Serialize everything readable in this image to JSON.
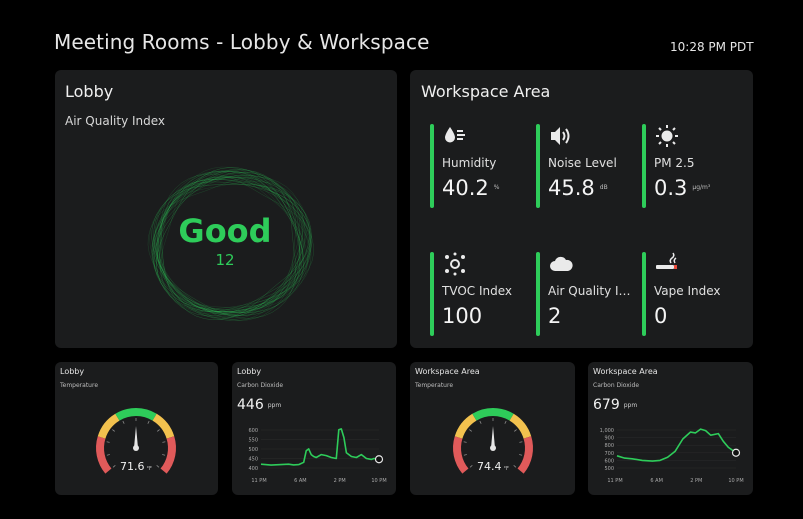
{
  "header": {
    "title": "Meeting Rooms - Lobby & Workspace",
    "time": "10:28 PM PDT"
  },
  "lobby": {
    "title": "Lobby",
    "subtitle": "Air Quality Index",
    "status": "Good",
    "value": "12",
    "status_color": "#2ecc5a"
  },
  "workspace": {
    "title": "Workspace Area",
    "metrics": [
      {
        "icon": "humidity-icon",
        "label": "Humidity",
        "value": "40.2",
        "unit": "%"
      },
      {
        "icon": "noise-icon",
        "label": "Noise Level",
        "value": "45.8",
        "unit": "dB"
      },
      {
        "icon": "sun-icon",
        "label": "PM 2.5",
        "value": "0.3",
        "unit": "µg/m³"
      },
      {
        "icon": "tvoc-icon",
        "label": "TVOC Index",
        "value": "100",
        "unit": ""
      },
      {
        "icon": "cloud-icon",
        "label": "Air Quality In...",
        "value": "2",
        "unit": ""
      },
      {
        "icon": "vape-icon",
        "label": "Vape Index",
        "value": "0",
        "unit": ""
      }
    ]
  },
  "widgets": {
    "lobby_temp": {
      "title": "Lobby",
      "subtitle": "Temperature",
      "value": "71.6",
      "unit": "°F",
      "fraction": 0.5
    },
    "lobby_co2": {
      "title": "Lobby",
      "subtitle": "Carbon Dioxide",
      "value": "446",
      "unit": "ppm"
    },
    "work_temp": {
      "title": "Workspace Area",
      "subtitle": "Temperature",
      "value": "74.4",
      "unit": "°F",
      "fraction": 0.5
    },
    "work_co2": {
      "title": "Workspace Area",
      "subtitle": "Carbon Dioxide",
      "value": "679",
      "unit": "ppm"
    }
  },
  "chart_data": [
    {
      "type": "line",
      "title": "Carbon Dioxide",
      "x_ticks": [
        "11 PM",
        "6 AM",
        "2 PM",
        "10 PM"
      ],
      "y_ticks": [
        "400",
        "450",
        "500",
        "550",
        "600"
      ],
      "ylim": [
        400,
        620
      ],
      "x": [
        0,
        4,
        8,
        11,
        13,
        15,
        17,
        18,
        19,
        20,
        21,
        22,
        24,
        26,
        28,
        30,
        31,
        32,
        33,
        34,
        36,
        38,
        40,
        42,
        44,
        45,
        47
      ],
      "values": [
        420,
        415,
        418,
        420,
        416,
        418,
        430,
        490,
        500,
        470,
        460,
        455,
        470,
        465,
        455,
        450,
        600,
        605,
        560,
        480,
        460,
        455,
        470,
        450,
        445,
        450,
        446
      ],
      "color": "#2ecc5a"
    },
    {
      "type": "line",
      "title": "Carbon Dioxide",
      "x_ticks": [
        "11 PM",
        "6 AM",
        "2 PM",
        "10 PM"
      ],
      "y_ticks": [
        "500",
        "600",
        "700",
        "800",
        "900",
        "1,000"
      ],
      "ylim": [
        500,
        1050
      ],
      "x": [
        0,
        3,
        6,
        10,
        14,
        17,
        20,
        23,
        26,
        29,
        31,
        33,
        35,
        37,
        40,
        42,
        44,
        47
      ],
      "values": [
        660,
        630,
        620,
        600,
        590,
        600,
        640,
        720,
        880,
        970,
        960,
        1010,
        990,
        930,
        950,
        850,
        770,
        700
      ],
      "color": "#2ecc5a"
    }
  ]
}
